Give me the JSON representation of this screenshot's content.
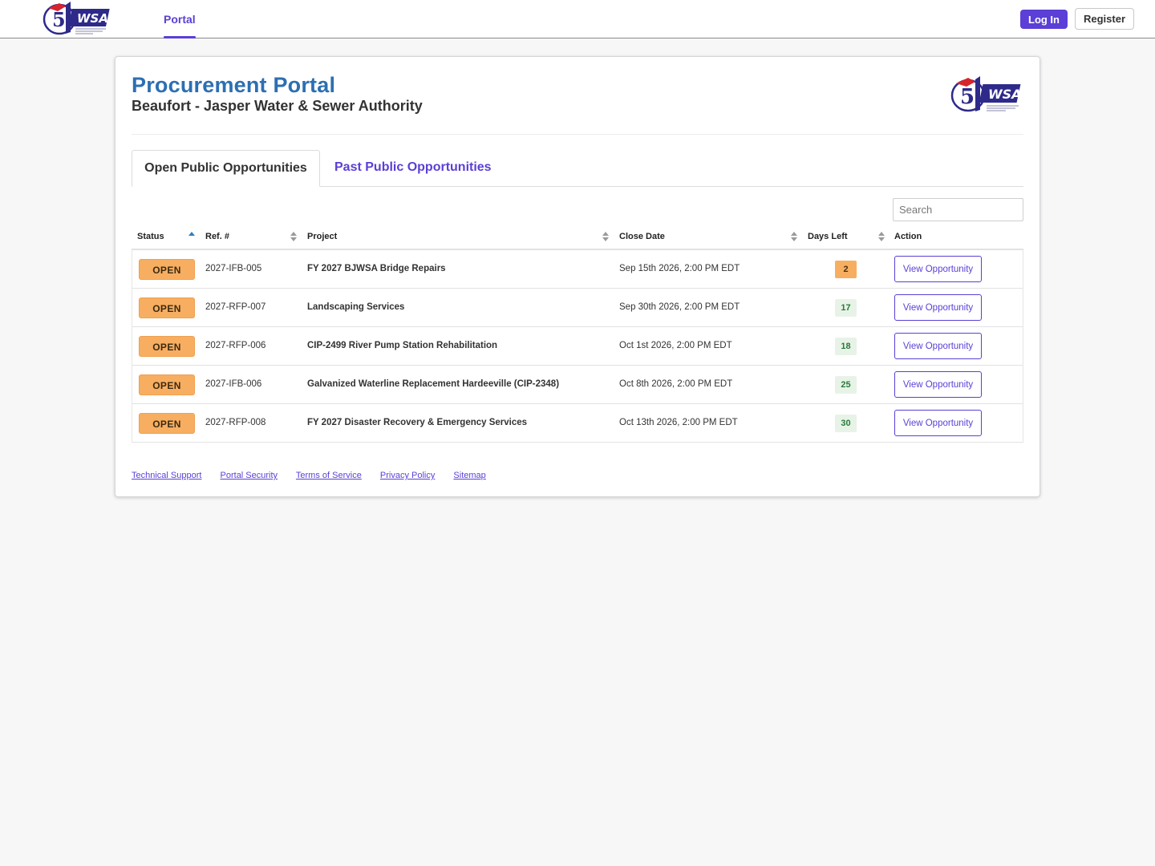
{
  "topbar": {
    "logo_icon": "bjwsa-logo-icon",
    "nav": {
      "portal_label": "Portal"
    },
    "login_label": "Log In",
    "register_label": "Register"
  },
  "card": {
    "title": "Procurement Portal",
    "subtitle": "Beaufort - Jasper Water & Sewer Authority",
    "logo_icon": "bjwsa-logo-icon"
  },
  "tabs": [
    {
      "label": "Open Public Opportunities",
      "active": true
    },
    {
      "label": "Past Public Opportunities",
      "active": false
    }
  ],
  "search": {
    "placeholder": "Search",
    "value": ""
  },
  "table": {
    "columns": [
      "Status",
      "Ref. #",
      "Project",
      "Close Date",
      "Days Left",
      "Action"
    ],
    "sorted_by": "Status",
    "rows": [
      {
        "status": "OPEN",
        "ref": "2027-IFB-005",
        "project": "FY 2027 BJWSA Bridge Repairs",
        "close_date": "Sep 15th 2026, 2:00 PM EDT",
        "days_left": "2",
        "urgent": true,
        "action": "View Opportunity"
      },
      {
        "status": "OPEN",
        "ref": "2027-RFP-007",
        "project": "Landscaping Services",
        "close_date": "Sep 30th 2026, 2:00 PM EDT",
        "days_left": "17",
        "urgent": false,
        "action": "View Opportunity"
      },
      {
        "status": "OPEN",
        "ref": "2027-RFP-006",
        "project": "CIP-2499 River Pump Station Rehabilitation",
        "close_date": "Oct 1st 2026, 2:00 PM EDT",
        "days_left": "18",
        "urgent": false,
        "action": "View Opportunity"
      },
      {
        "status": "OPEN",
        "ref": "2027-IFB-006",
        "project": "Galvanized Waterline Replacement Hardeeville (CIP-2348)",
        "close_date": "Oct 8th 2026, 2:00 PM EDT",
        "days_left": "25",
        "urgent": false,
        "action": "View Opportunity"
      },
      {
        "status": "OPEN",
        "ref": "2027-RFP-008",
        "project": "FY 2027 Disaster Recovery & Emergency Services",
        "close_date": "Oct 13th 2026, 2:00 PM EDT",
        "days_left": "30",
        "urgent": false,
        "action": "View Opportunity"
      }
    ]
  },
  "footer": {
    "links": [
      "Technical Support",
      "Portal Security",
      "Terms of Service",
      "Privacy Policy",
      "Sitemap"
    ]
  },
  "colors": {
    "brand_purple": "#5b3fd6",
    "title_blue": "#2c6fb2",
    "open_badge": "#f7ae61",
    "days_ok": "#e8f3e8"
  }
}
